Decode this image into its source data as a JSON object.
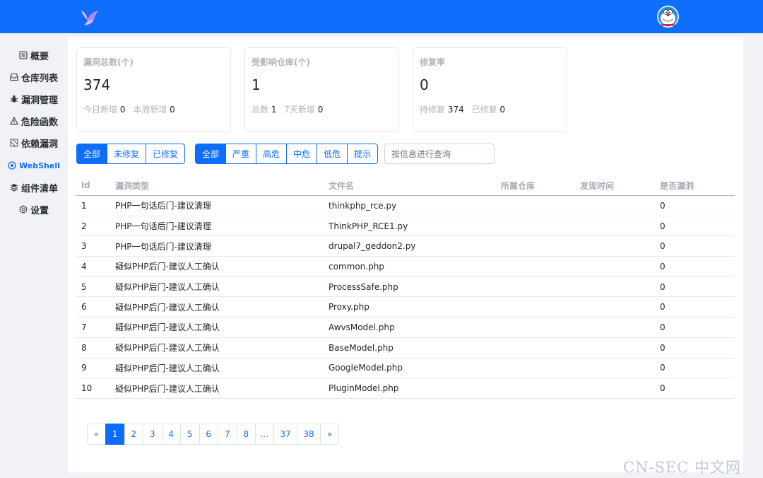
{
  "sidebar": {
    "items": [
      {
        "label": "概要",
        "icon": "list-icon"
      },
      {
        "label": "仓库列表",
        "icon": "inbox-icon"
      },
      {
        "label": "漏洞管理",
        "icon": "bug-icon"
      },
      {
        "label": "危险函数",
        "icon": "warning-icon"
      },
      {
        "label": "依赖漏洞",
        "icon": "dependency-icon"
      },
      {
        "label": "WebShell",
        "icon": "webshell-icon"
      },
      {
        "label": "组件清单",
        "icon": "layers-icon"
      },
      {
        "label": "设置",
        "icon": "gear-icon"
      }
    ]
  },
  "cards": [
    {
      "title": "漏洞总数(个)",
      "value": "374",
      "sub": [
        {
          "label": "今日新增",
          "value": "0"
        },
        {
          "label": "本周新增",
          "value": "0"
        }
      ]
    },
    {
      "title": "受影响仓库(个)",
      "value": "1",
      "sub": [
        {
          "label": "总数",
          "value": "1"
        },
        {
          "label": "7天新增",
          "value": "0"
        }
      ]
    },
    {
      "title": "修复率",
      "value": "0",
      "sub": [
        {
          "label": "待修复",
          "value": "374"
        },
        {
          "label": "已修复",
          "value": "0"
        }
      ]
    }
  ],
  "status_filter": [
    "全部",
    "未修复",
    "已修复"
  ],
  "level_filter": [
    "全部",
    "严重",
    "高危",
    "中危",
    "低危",
    "提示"
  ],
  "search": {
    "placeholder": "按信息进行查询",
    "value": ""
  },
  "table": {
    "headers": [
      "id",
      "漏洞类型",
      "文件名",
      "所属仓库",
      "发现时间",
      "是否漏洞"
    ],
    "rows": [
      [
        "1",
        "PHP一句话后门-建议清理",
        "thinkphp_rce.py",
        "",
        "",
        "0"
      ],
      [
        "2",
        "PHP一句话后门-建议清理",
        "ThinkPHP_RCE1.py",
        "",
        "",
        "0"
      ],
      [
        "3",
        "PHP一句话后门-建议清理",
        "drupal7_geddon2.py",
        "",
        "",
        "0"
      ],
      [
        "4",
        "疑似PHP后门-建议人工确认",
        "common.php",
        "",
        "",
        "0"
      ],
      [
        "5",
        "疑似PHP后门-建议人工确认",
        "ProcessSafe.php",
        "",
        "",
        "0"
      ],
      [
        "6",
        "疑似PHP后门-建议人工确认",
        "Proxy.php",
        "",
        "",
        "0"
      ],
      [
        "7",
        "疑似PHP后门-建议人工确认",
        "AwvsModel.php",
        "",
        "",
        "0"
      ],
      [
        "8",
        "疑似PHP后门-建议人工确认",
        "BaseModel.php",
        "",
        "",
        "0"
      ],
      [
        "9",
        "疑似PHP后门-建议人工确认",
        "GoogleModel.php",
        "",
        "",
        "0"
      ],
      [
        "10",
        "疑似PHP后门-建议人工确认",
        "PluginModel.php",
        "",
        "",
        "0"
      ]
    ]
  },
  "pagination": [
    "«",
    "1",
    "2",
    "3",
    "4",
    "5",
    "6",
    "7",
    "8",
    "...",
    "37",
    "38",
    "»"
  ],
  "pagination_current": "1",
  "watermark": "CN-SEC 中文网",
  "colors": {
    "primary": "#0d6efd",
    "background": "#f0f2f5"
  }
}
